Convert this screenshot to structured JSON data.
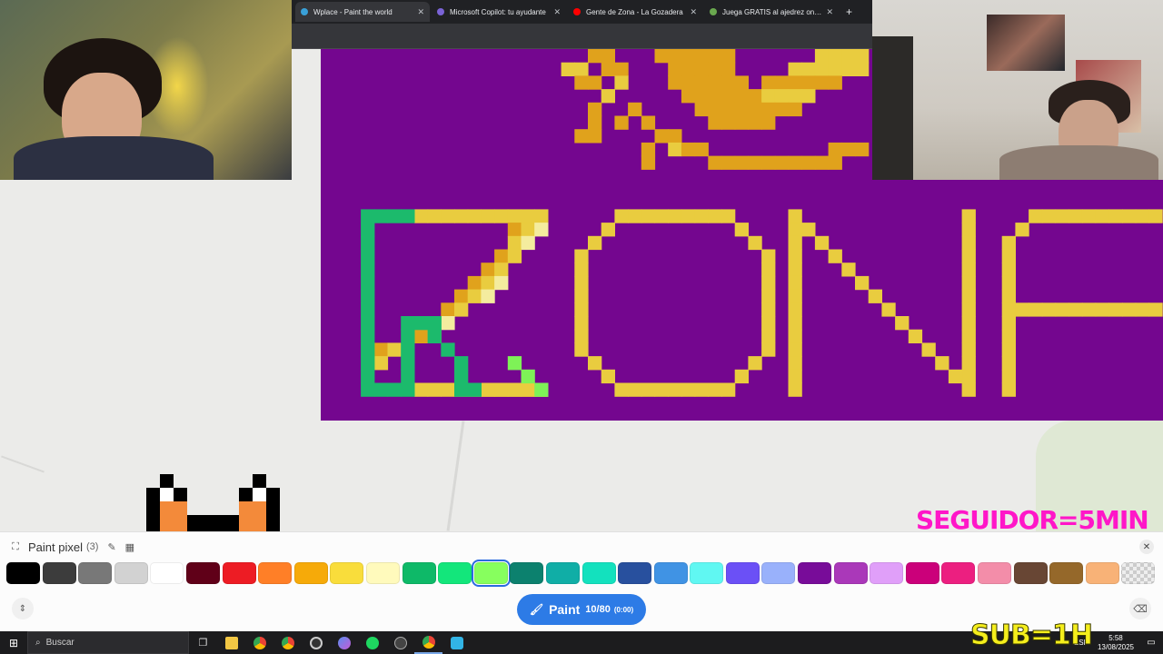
{
  "browser": {
    "tabs": [
      {
        "title": "Wplace - Paint the world",
        "favicon_color": "#39a0d8",
        "active": true
      },
      {
        "title": "Microsoft Copilot: tu ayudante",
        "favicon_color": "#7a63d6",
        "active": false
      },
      {
        "title": "Gente de Zona - La Gozadera",
        "favicon_color": "#ff0000",
        "active": false
      },
      {
        "title": "Juega GRATIS al ajedrez online",
        "favicon_color": "#6aa84f",
        "active": false
      }
    ],
    "new_tab_icon": "plus-icon"
  },
  "canvas": {
    "background": "#74068f",
    "palette_keys": {
      "Y": "#e9cc3f",
      "O": "#e0a21c",
      "G": "#1cba6c",
      "L": "#f4ec9e",
      "S": "#7ef257"
    }
  },
  "overlays": {
    "seguidor": "SEGUIDOR=5MIN",
    "sub": "SUB=1H"
  },
  "panel": {
    "title": "Paint pixel",
    "count": "(3)",
    "paint_label": "Paint",
    "charges": "10/80",
    "timer": "(0:00)",
    "selected_color": "#87ff5e",
    "colors": [
      "#000000",
      "#3c3c3c",
      "#787878",
      "#d2d2d2",
      "#ffffff",
      "#600018",
      "#ed1c24",
      "#ff7f27",
      "#f6aa09",
      "#f9dd3b",
      "#fffabc",
      "#0eb968",
      "#13e67b",
      "#87ff5e",
      "#0c816e",
      "#10aea6",
      "#13e1be",
      "#28509e",
      "#4093e4",
      "#60f7f2",
      "#6b50f6",
      "#99b1fb",
      "#780c99",
      "#aa38b9",
      "#e09ff9",
      "#cb007a",
      "#ec1f80",
      "#f38da9",
      "#684634",
      "#95682a",
      "#f8b277",
      "transparent"
    ]
  },
  "taskbar": {
    "search_placeholder": "Buscar",
    "lang": "ESP",
    "time": "5:58",
    "date": "13/08/2025"
  }
}
